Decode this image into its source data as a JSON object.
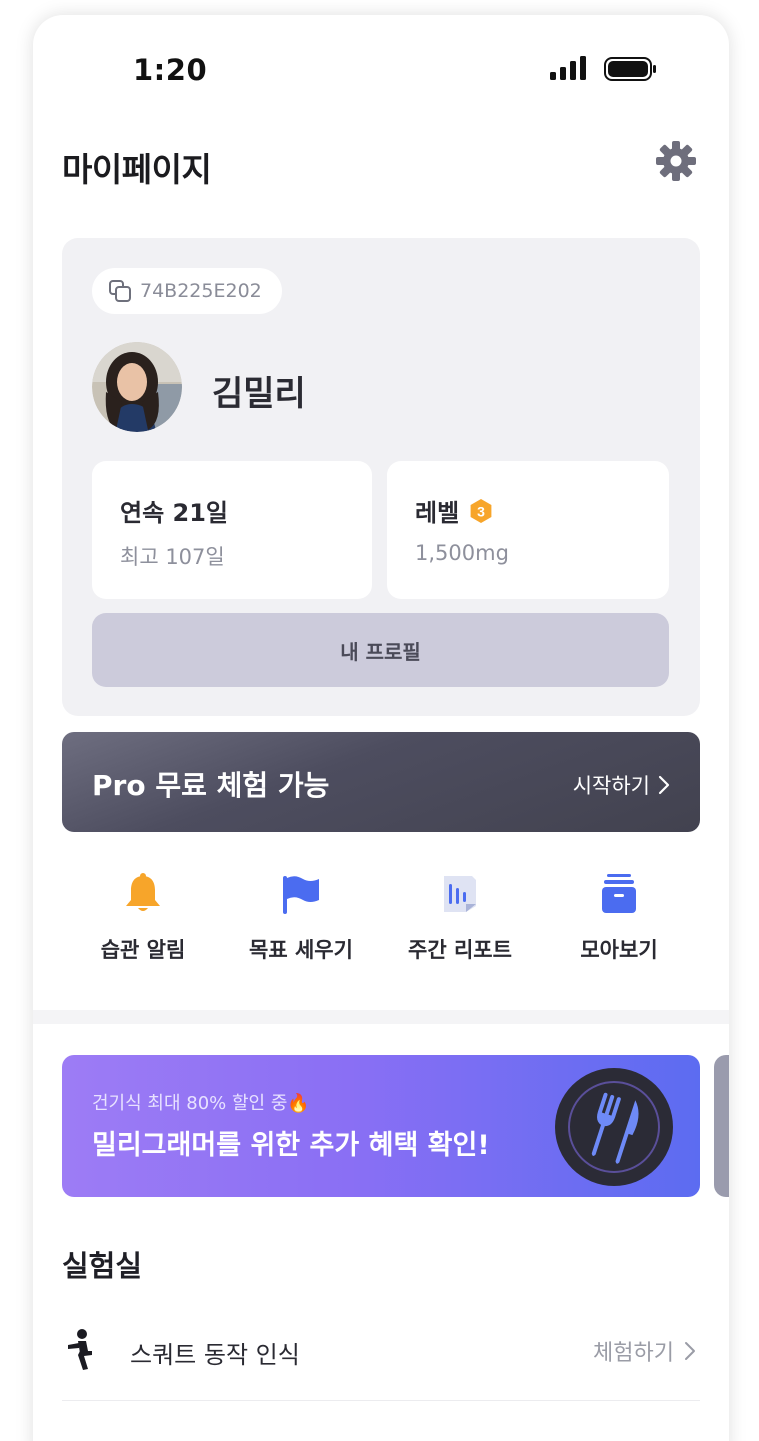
{
  "status_bar": {
    "time": "1:20"
  },
  "header": {
    "title": "마이페이지"
  },
  "profile": {
    "id": "74B225E202",
    "name": "김밀리",
    "streak": {
      "title": "연속 21일",
      "best": "최고 107일"
    },
    "level": {
      "title": "레벨",
      "badge": "3",
      "value": "1,500mg"
    },
    "profile_button": "내 프로필"
  },
  "pro_banner": {
    "title": "Pro 무료 체험 가능",
    "cta": "시작하기"
  },
  "quick_menu": [
    {
      "label": "습관 알림",
      "icon": "bell-icon"
    },
    {
      "label": "목표 세우기",
      "icon": "flag-icon"
    },
    {
      "label": "주간 리포트",
      "icon": "report-icon"
    },
    {
      "label": "모아보기",
      "icon": "archive-icon"
    }
  ],
  "promo": {
    "subtitle": "건기식 최대 80% 할인 중🔥",
    "title": "밀리그래머를 위한 추가 혜택 확인!"
  },
  "lab": {
    "title": "실험실",
    "items": [
      {
        "label": "스쿼트 동작 인식",
        "cta": "체험하기"
      }
    ]
  },
  "colors": {
    "accent_orange": "#f7a52a",
    "accent_blue": "#4b6cf0",
    "pro_banner": "#4d4d5f",
    "promo_start": "#9d7cf5",
    "promo_end": "#5c6cf1"
  }
}
